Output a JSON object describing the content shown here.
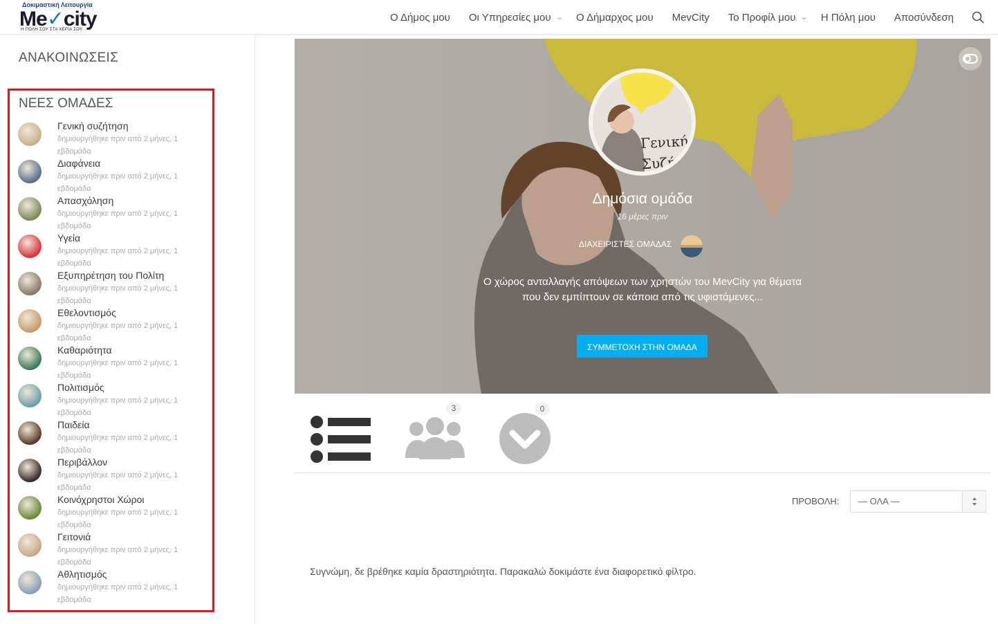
{
  "brand": {
    "top_text": "Δοκιμαστική Λειτουργία",
    "name_a": "Me",
    "name_b": "city",
    "tagline": "Η ΠΟΛΗ ΣΟΥ ΣΤΑ ΧΕΡΙΑ ΣΟΥ"
  },
  "nav": [
    {
      "label": "Ο Δήμος μου",
      "dropdown": false
    },
    {
      "label": "Οι Υπηρεσίες μου",
      "dropdown": true
    },
    {
      "label": "Ο Δήμαρχος μου",
      "dropdown": false
    },
    {
      "label": "MevCity",
      "dropdown": false
    },
    {
      "label": "Το Προφίλ μου",
      "dropdown": true
    },
    {
      "label": "Η Πόλη μου",
      "dropdown": false
    },
    {
      "label": "Αποσύνδεση",
      "dropdown": false
    }
  ],
  "sidebar": {
    "announcements_title": "ΑΝΑΚΟΙΝΩΣΕΙΣ",
    "new_groups_title": "ΝΕΕΣ ΟΜΑΔΕΣ",
    "groups": [
      {
        "name": "Γενική συζήτηση",
        "meta": "δημιουργήθηκε πριν από 2 μήνες, 1 εβδομάδα",
        "color": "#c9b08a"
      },
      {
        "name": "Διαφάνεια",
        "meta": "δημιουργήθηκε πριν από 2 μήνες, 1 εβδομάδα",
        "color": "#5a6e8c"
      },
      {
        "name": "Απασχόληση",
        "meta": "δημιουργήθηκε πριν από 2 μήνες, 1 εβδομάδα",
        "color": "#7a8a5a"
      },
      {
        "name": "Υγεία",
        "meta": "δημιουργήθηκε πριν από 2 μήνες, 1 εβδομάδα",
        "color": "#d8323a"
      },
      {
        "name": "Εξυπηρέτηση του Πολίτη",
        "meta": "δημιουργήθηκε πριν από 2 μήνες, 1 εβδομάδα",
        "color": "#8a7a6a"
      },
      {
        "name": "Εθελοντισμός",
        "meta": "δημιουργήθηκε πριν από 2 μήνες, 1 εβδομάδα",
        "color": "#c99a6a"
      },
      {
        "name": "Καθαριότητα",
        "meta": "δημιουργήθηκε πριν από 2 μήνες, 1 εβδομάδα",
        "color": "#3c7a5a"
      },
      {
        "name": "Πολιτισμός",
        "meta": "δημιουργήθηκε πριν από 2 μήνες, 1 εβδομάδα",
        "color": "#6aa0a8"
      },
      {
        "name": "Παιδεία",
        "meta": "δημιουργήθηκε πριν από 2 μήνες, 1 εβδομάδα",
        "color": "#5a3a2a"
      },
      {
        "name": "Περιβάλλον",
        "meta": "δημιουργήθηκε πριν από 2 μήνες, 1 εβδομάδα",
        "color": "#3a2a2a"
      },
      {
        "name": "Κοινόχρηστοι Χώροι",
        "meta": "δημιουργήθηκε πριν από 2 μήνες, 1 εβδομάδα",
        "color": "#6a8a3a"
      },
      {
        "name": "Γειτονιά",
        "meta": "δημιουργήθηκε πριν από 2 μήνες, 1 εβδομάδα",
        "color": "#c8a888"
      },
      {
        "name": "Αθλητισμός",
        "meta": "δημιουργήθηκε πριν από 2 μήνες, 1 εβδομάδα",
        "color": "#8aa0b8"
      }
    ]
  },
  "hero": {
    "photo_text_line1": "Γενική",
    "photo_text_line2": "Συζήτησ",
    "group_type": "Δημόσια ομάδα",
    "time": "16 μέρες πριν",
    "admins_label": "ΔΙΑΧΕΙΡΙΣΤΕΣ ΟΜΑΔΑΣ",
    "description": "Ο χώρος ανταλλαγής απόψεων των χρηστών του MevCity για θέματα που δεν εμπίπτουν σε κάποια από τις υφιστάμενες...",
    "join_label": "ΣΥΜΜΕΤΟΧΗ ΣΤΗΝ ΟΜΑΔΑ"
  },
  "tabs": {
    "members_count": "3",
    "requests_count": "0"
  },
  "filter": {
    "label": "ΠΡΟΒΟΛΗ:",
    "selected": "— ΟΛΑ —"
  },
  "empty_message": "Συγνώμη, δε βρέθηκε καμία δραστηριότητα. Παρακαλώ δοκιμάστε ένα διαφορετικό φίλτρο.",
  "colors": {
    "accent": "#00aeef",
    "highlight_border": "#e3151c",
    "brand_blue": "#1e73be",
    "bubble_yellow": "#f6e24a"
  },
  "icons": [
    "search-icon",
    "toggle-icon",
    "activity-list-icon",
    "members-icon",
    "requests-icon",
    "select-arrows-icon"
  ]
}
